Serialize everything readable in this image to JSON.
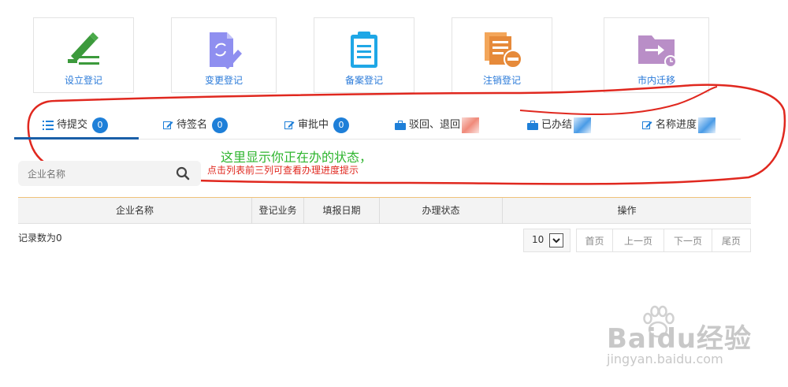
{
  "tiles": [
    {
      "label": "设立登记",
      "icon": "pen-list-icon"
    },
    {
      "label": "变更登记",
      "icon": "document-edit-icon"
    },
    {
      "label": "备案登记",
      "icon": "clipboard-icon"
    },
    {
      "label": "注销登记",
      "icon": "documents-cancel-icon"
    },
    {
      "label": "市内迁移",
      "icon": "folder-move-icon"
    }
  ],
  "tabs": [
    {
      "label": "待提交",
      "count": "0",
      "icon": "list-icon"
    },
    {
      "label": "待签名",
      "count": "0",
      "icon": "edit-icon"
    },
    {
      "label": "审批中",
      "count": "0",
      "icon": "edit-icon"
    },
    {
      "label": "驳回、退回",
      "icon": "briefcase-icon"
    },
    {
      "label": "已办结",
      "icon": "briefcase-icon"
    },
    {
      "label": "名称进度",
      "icon": "edit-icon"
    }
  ],
  "annotation": {
    "main": "这里显示你正在办的状态，",
    "sub": "点击列表前三列可查看办理进度提示"
  },
  "search": {
    "placeholder": "企业名称"
  },
  "table": {
    "headers": [
      "企业名称",
      "登记业务",
      "填报日期",
      "办理状态",
      "操作"
    ]
  },
  "record_count": "记录数为0",
  "pager": {
    "page_size": "10",
    "first": "首页",
    "prev": "上一页",
    "next": "下一页",
    "last": "尾页"
  },
  "watermark": {
    "brand": "Baidu经验",
    "url": "jingyan.baidu.com"
  },
  "colors": {
    "accent": "#1e7fd8",
    "annotation_green": "#2fb52f",
    "annotation_red": "#e0281f"
  }
}
